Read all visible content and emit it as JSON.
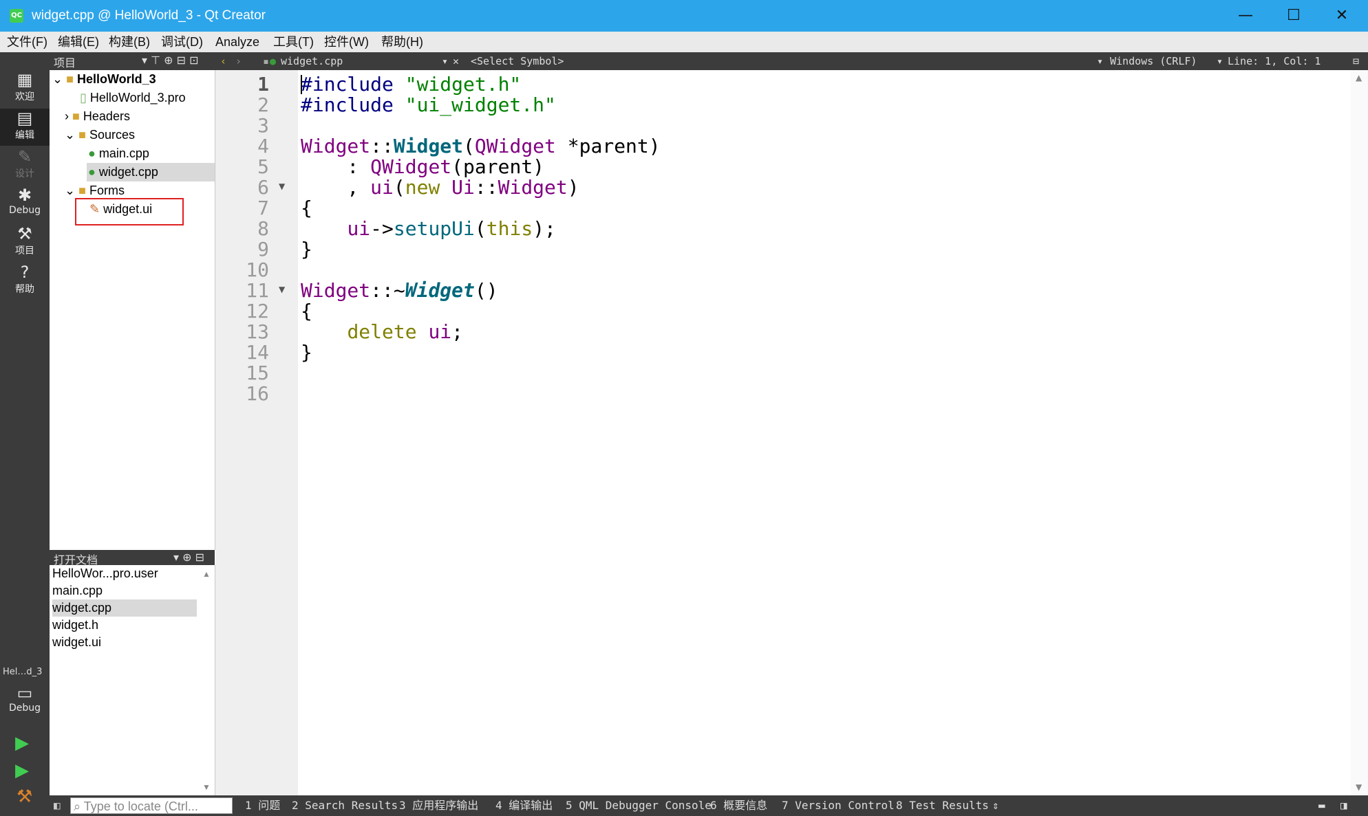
{
  "window": {
    "title": "widget.cpp @ HelloWorld_3 - Qt Creator",
    "app_icon": "QC",
    "min": "—",
    "max": "☐",
    "close": "✕"
  },
  "menu": [
    "文件(F)",
    "编辑(E)",
    "构建(B)",
    "调试(D)",
    "Analyze",
    "工具(T)",
    "控件(W)",
    "帮助(H)"
  ],
  "modes": [
    {
      "label": "欢迎",
      "icon": "grid-icon",
      "glyph": "▦"
    },
    {
      "label": "编辑",
      "icon": "edit-doc-icon",
      "glyph": "▤"
    },
    {
      "label": "设计",
      "icon": "pencil-icon",
      "glyph": "✎"
    },
    {
      "label": "Debug",
      "icon": "bug-icon",
      "glyph": "✱"
    },
    {
      "label": "项目",
      "icon": "wrench-icon",
      "glyph": "⚒"
    },
    {
      "label": "帮助",
      "icon": "help-icon",
      "glyph": "?"
    }
  ],
  "kit": {
    "name": "Hel…d_3",
    "mode": "Debug"
  },
  "project_pane": {
    "header": "项目",
    "tree": [
      {
        "label": "HelloWorld_3",
        "indent": 0,
        "arrow": "⌄",
        "bold": true,
        "icon": "project-folder-icon"
      },
      {
        "label": "HelloWorld_3.pro",
        "indent": 1,
        "arrow": "",
        "icon": "pro-file-icon"
      },
      {
        "label": "Headers",
        "indent": 1,
        "arrow": "›",
        "icon": "folder-icon"
      },
      {
        "label": "Sources",
        "indent": 1,
        "arrow": "⌄",
        "icon": "folder-icon"
      },
      {
        "label": "main.cpp",
        "indent": 2,
        "arrow": "",
        "icon": "cpp-file-icon"
      },
      {
        "label": "widget.cpp",
        "indent": 2,
        "arrow": "",
        "icon": "cpp-file-icon",
        "selected": true
      },
      {
        "label": "Forms",
        "indent": 1,
        "arrow": "⌄",
        "icon": "folder-icon"
      },
      {
        "label": "widget.ui",
        "indent": 2,
        "arrow": "",
        "icon": "ui-file-icon",
        "highlighted": true
      }
    ]
  },
  "open_docs": {
    "header": "打开文档",
    "items": [
      "HelloWor...pro.user",
      "main.cpp",
      "widget.cpp",
      "widget.h",
      "widget.ui"
    ],
    "selected_index": 2
  },
  "editor_toolbar": {
    "file": "widget.cpp",
    "symbol": "<Select Symbol>",
    "line_ending": "Windows (CRLF)",
    "position": "Line: 1, Col: 1"
  },
  "code": {
    "current_line": 1,
    "lines": [
      [
        [
          "kw-pp",
          "#include "
        ],
        [
          "str",
          "\"widget.h\""
        ]
      ],
      [
        [
          "kw-pp",
          "#include "
        ],
        [
          "str",
          "\"ui_widget.h\""
        ]
      ],
      [],
      [
        [
          "ty",
          "Widget"
        ],
        [
          "pl",
          "::"
        ],
        [
          "fn",
          "Widget"
        ],
        [
          "pl",
          "("
        ],
        [
          "ty",
          "QWidget"
        ],
        [
          "pl",
          " *"
        ],
        [
          "pl",
          "parent"
        ],
        [
          "pl",
          ")"
        ]
      ],
      [
        [
          "pl",
          "    : "
        ],
        [
          "ty",
          "QWidget"
        ],
        [
          "pl",
          "(parent)"
        ]
      ],
      [
        [
          "pl",
          "    , "
        ],
        [
          "ty",
          "ui"
        ],
        [
          "pl",
          "("
        ],
        [
          "kw",
          "new "
        ],
        [
          "ty",
          "Ui"
        ],
        [
          "pl",
          "::"
        ],
        [
          "ty",
          "Widget"
        ],
        [
          "pl",
          ")"
        ]
      ],
      [
        [
          "pl",
          "{"
        ]
      ],
      [
        [
          "pl",
          "    "
        ],
        [
          "ty",
          "ui"
        ],
        [
          "pl",
          "->"
        ],
        [
          "fnn",
          "setupUi"
        ],
        [
          "pl",
          "("
        ],
        [
          "kw",
          "this"
        ],
        [
          "pl",
          ");"
        ]
      ],
      [
        [
          "pl",
          "}"
        ]
      ],
      [],
      [
        [
          "ty",
          "Widget"
        ],
        [
          "pl",
          "::~"
        ],
        [
          "fni",
          "Widget"
        ],
        [
          "pl",
          "()"
        ]
      ],
      [
        [
          "pl",
          "{"
        ]
      ],
      [
        [
          "pl",
          "    "
        ],
        [
          "kw",
          "delete "
        ],
        [
          "ty",
          "ui"
        ],
        [
          "pl",
          ";"
        ]
      ],
      [
        [
          "pl",
          "}"
        ]
      ],
      [],
      []
    ],
    "fold_lines": [
      6,
      11
    ]
  },
  "bottom": {
    "locate_placeholder": "Type to locate (Ctrl...",
    "tabs": [
      "1 问题",
      "2 Search Results",
      "3 应用程序输出",
      "4 编译输出",
      "5 QML Debugger Console",
      "6 概要信息",
      "7 Version Control",
      "8 Test Results"
    ]
  }
}
